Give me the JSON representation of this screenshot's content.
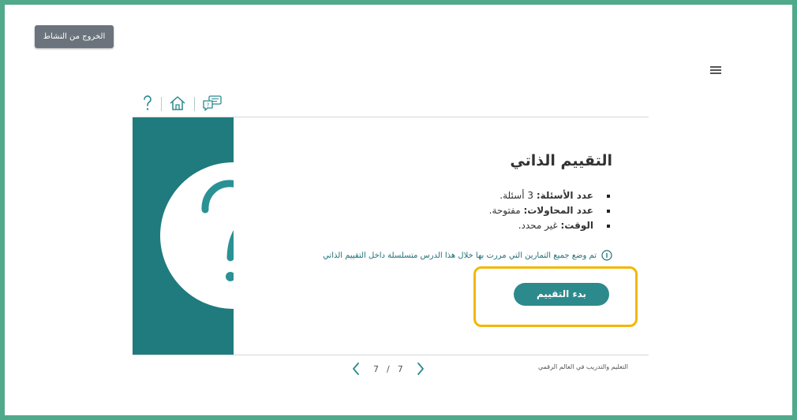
{
  "exit_button": {
    "label": "الخروج من النشاط"
  },
  "toolbar": {
    "items": [
      {
        "icon": "question-mark-icon"
      },
      {
        "icon": "home-icon"
      },
      {
        "icon": "chat-help-icon"
      }
    ]
  },
  "assessment": {
    "title": "التقييم الذاتي",
    "details": [
      {
        "label": "عدد الأسئلة:",
        "value": "3 أسئلة."
      },
      {
        "label": "عدد المحاولات:",
        "value": "مفتوحة."
      },
      {
        "label": "الوقت:",
        "value": "غير محدد."
      }
    ],
    "note_icon": "info-circle-icon",
    "note": "تم وضع جميع التمارين التي مررت بها خلال هذا الدرس متسلسلة داخل التقييم الذاتي",
    "start_button": "بدء التقييم"
  },
  "pagination": {
    "current": "7",
    "total": "7",
    "separator": "/"
  },
  "footer": {
    "brand": "التعليم والتدريب في العالم الرقمي"
  },
  "colors": {
    "outer_border": "#4fa98a",
    "teal_panel": "#1f7b7d",
    "accent": "#2d8a8c",
    "highlight": "#f2b707",
    "exit_button": "#6b747c"
  }
}
